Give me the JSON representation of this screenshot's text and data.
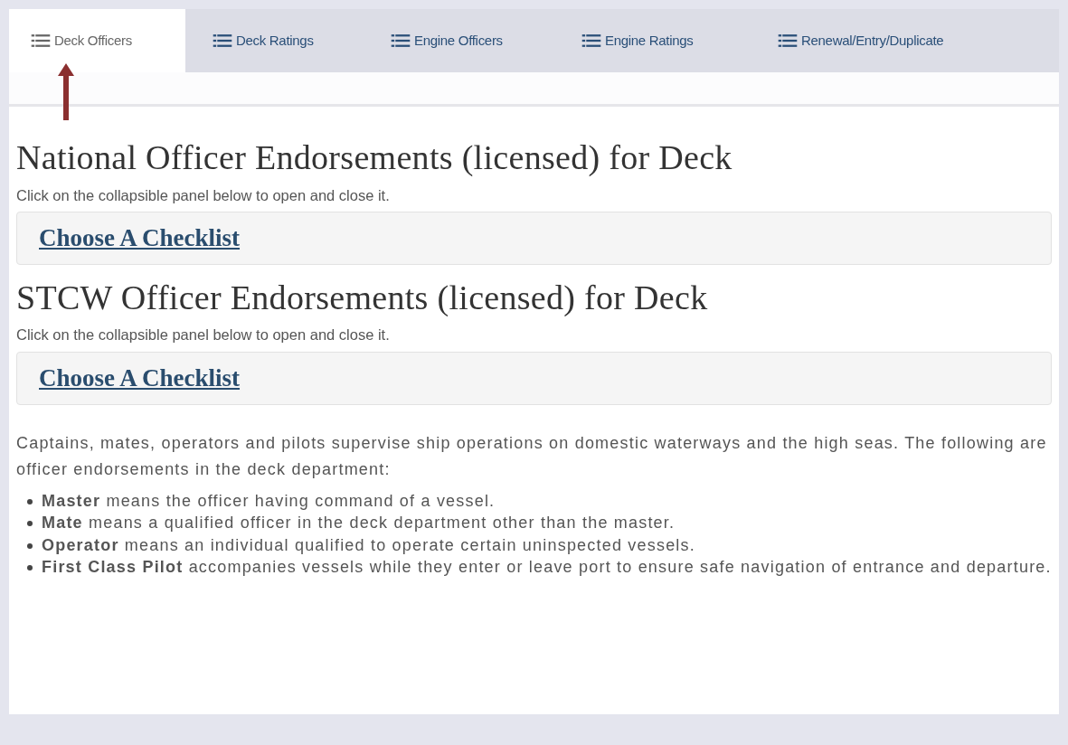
{
  "tabs": [
    {
      "label": "Deck Officers",
      "selected": true
    },
    {
      "label": "Deck Ratings",
      "selected": false
    },
    {
      "label": "Engine Officers",
      "selected": false
    },
    {
      "label": "Engine Ratings",
      "selected": false
    },
    {
      "label": "Renewal/Entry/Duplicate",
      "selected": false
    }
  ],
  "sections": [
    {
      "heading": "National Officer Endorsements (licensed) for Deck",
      "instruction": "Click on the collapsible panel below to open and close it.",
      "panel_link": "Choose A Checklist"
    },
    {
      "heading": "STCW Officer Endorsements (licensed) for Deck",
      "instruction": "Click on the collapsible panel below to open and close it.",
      "panel_link": "Choose A Checklist"
    }
  ],
  "intro": "Captains, mates, operators and pilots supervise ship operations on domestic waterways and the high seas. The following are officer endorsements in the deck department:",
  "definitions": [
    "**Master** means the officer having command of a vessel.",
    "**Mate** means a qualified officer in the deck department other than the master.",
    "**Operator** means an individual qualified to operate certain uninspected vessels.",
    "**First Class Pilot** accompanies vessels while they enter or leave port to ensure safe navigation of entrance and departure."
  ]
}
